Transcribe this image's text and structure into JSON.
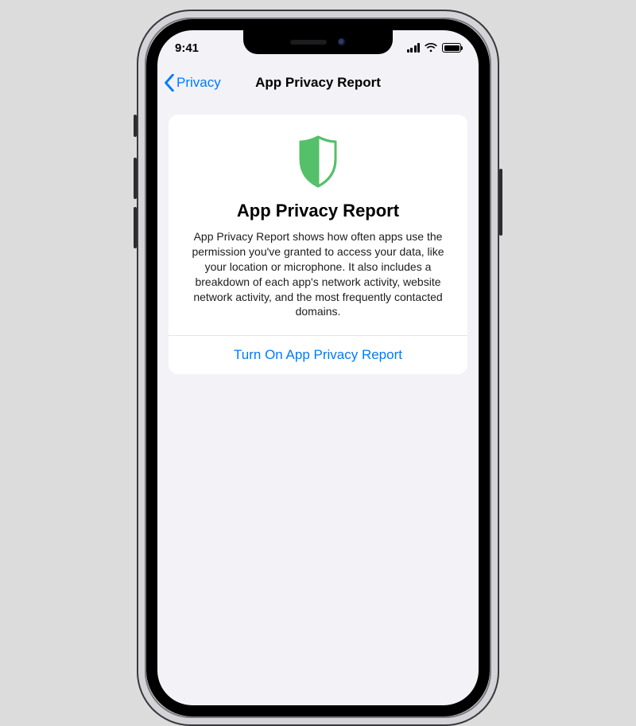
{
  "status": {
    "time": "9:41"
  },
  "nav": {
    "back_label": "Privacy",
    "title": "App Privacy Report"
  },
  "card": {
    "title": "App Privacy Report",
    "description": "App Privacy Report shows how often apps use the permission you've granted to access your data, like your location or microphone. It also includes a breakdown of each app's network activity, website network activity, and the most frequently contacted domains.",
    "action_label": "Turn On App Privacy Report"
  },
  "colors": {
    "ios_blue": "#007aff",
    "shield_green": "#55c06a",
    "bg_grouped": "#f2f2f7"
  },
  "icons": {
    "back": "chevron-left-icon",
    "shield": "shield-icon",
    "signal": "cellular-signal-icon",
    "wifi": "wifi-icon",
    "battery": "battery-icon"
  }
}
